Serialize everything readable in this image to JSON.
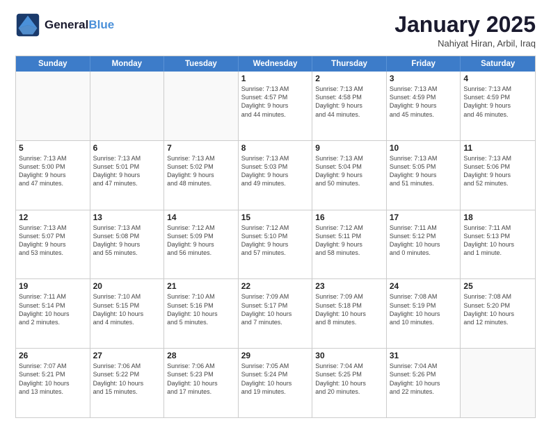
{
  "logo": {
    "line1": "General",
    "line2": "Blue"
  },
  "title": "January 2025",
  "subtitle": "Nahiyat Hiran, Arbil, Iraq",
  "days": [
    "Sunday",
    "Monday",
    "Tuesday",
    "Wednesday",
    "Thursday",
    "Friday",
    "Saturday"
  ],
  "weeks": [
    [
      {
        "num": "",
        "info": ""
      },
      {
        "num": "",
        "info": ""
      },
      {
        "num": "",
        "info": ""
      },
      {
        "num": "1",
        "info": "Sunrise: 7:13 AM\nSunset: 4:57 PM\nDaylight: 9 hours\nand 44 minutes."
      },
      {
        "num": "2",
        "info": "Sunrise: 7:13 AM\nSunset: 4:58 PM\nDaylight: 9 hours\nand 44 minutes."
      },
      {
        "num": "3",
        "info": "Sunrise: 7:13 AM\nSunset: 4:59 PM\nDaylight: 9 hours\nand 45 minutes."
      },
      {
        "num": "4",
        "info": "Sunrise: 7:13 AM\nSunset: 4:59 PM\nDaylight: 9 hours\nand 46 minutes."
      }
    ],
    [
      {
        "num": "5",
        "info": "Sunrise: 7:13 AM\nSunset: 5:00 PM\nDaylight: 9 hours\nand 47 minutes."
      },
      {
        "num": "6",
        "info": "Sunrise: 7:13 AM\nSunset: 5:01 PM\nDaylight: 9 hours\nand 47 minutes."
      },
      {
        "num": "7",
        "info": "Sunrise: 7:13 AM\nSunset: 5:02 PM\nDaylight: 9 hours\nand 48 minutes."
      },
      {
        "num": "8",
        "info": "Sunrise: 7:13 AM\nSunset: 5:03 PM\nDaylight: 9 hours\nand 49 minutes."
      },
      {
        "num": "9",
        "info": "Sunrise: 7:13 AM\nSunset: 5:04 PM\nDaylight: 9 hours\nand 50 minutes."
      },
      {
        "num": "10",
        "info": "Sunrise: 7:13 AM\nSunset: 5:05 PM\nDaylight: 9 hours\nand 51 minutes."
      },
      {
        "num": "11",
        "info": "Sunrise: 7:13 AM\nSunset: 5:06 PM\nDaylight: 9 hours\nand 52 minutes."
      }
    ],
    [
      {
        "num": "12",
        "info": "Sunrise: 7:13 AM\nSunset: 5:07 PM\nDaylight: 9 hours\nand 53 minutes."
      },
      {
        "num": "13",
        "info": "Sunrise: 7:13 AM\nSunset: 5:08 PM\nDaylight: 9 hours\nand 55 minutes."
      },
      {
        "num": "14",
        "info": "Sunrise: 7:12 AM\nSunset: 5:09 PM\nDaylight: 9 hours\nand 56 minutes."
      },
      {
        "num": "15",
        "info": "Sunrise: 7:12 AM\nSunset: 5:10 PM\nDaylight: 9 hours\nand 57 minutes."
      },
      {
        "num": "16",
        "info": "Sunrise: 7:12 AM\nSunset: 5:11 PM\nDaylight: 9 hours\nand 58 minutes."
      },
      {
        "num": "17",
        "info": "Sunrise: 7:11 AM\nSunset: 5:12 PM\nDaylight: 10 hours\nand 0 minutes."
      },
      {
        "num": "18",
        "info": "Sunrise: 7:11 AM\nSunset: 5:13 PM\nDaylight: 10 hours\nand 1 minute."
      }
    ],
    [
      {
        "num": "19",
        "info": "Sunrise: 7:11 AM\nSunset: 5:14 PM\nDaylight: 10 hours\nand 2 minutes."
      },
      {
        "num": "20",
        "info": "Sunrise: 7:10 AM\nSunset: 5:15 PM\nDaylight: 10 hours\nand 4 minutes."
      },
      {
        "num": "21",
        "info": "Sunrise: 7:10 AM\nSunset: 5:16 PM\nDaylight: 10 hours\nand 5 minutes."
      },
      {
        "num": "22",
        "info": "Sunrise: 7:09 AM\nSunset: 5:17 PM\nDaylight: 10 hours\nand 7 minutes."
      },
      {
        "num": "23",
        "info": "Sunrise: 7:09 AM\nSunset: 5:18 PM\nDaylight: 10 hours\nand 8 minutes."
      },
      {
        "num": "24",
        "info": "Sunrise: 7:08 AM\nSunset: 5:19 PM\nDaylight: 10 hours\nand 10 minutes."
      },
      {
        "num": "25",
        "info": "Sunrise: 7:08 AM\nSunset: 5:20 PM\nDaylight: 10 hours\nand 12 minutes."
      }
    ],
    [
      {
        "num": "26",
        "info": "Sunrise: 7:07 AM\nSunset: 5:21 PM\nDaylight: 10 hours\nand 13 minutes."
      },
      {
        "num": "27",
        "info": "Sunrise: 7:06 AM\nSunset: 5:22 PM\nDaylight: 10 hours\nand 15 minutes."
      },
      {
        "num": "28",
        "info": "Sunrise: 7:06 AM\nSunset: 5:23 PM\nDaylight: 10 hours\nand 17 minutes."
      },
      {
        "num": "29",
        "info": "Sunrise: 7:05 AM\nSunset: 5:24 PM\nDaylight: 10 hours\nand 19 minutes."
      },
      {
        "num": "30",
        "info": "Sunrise: 7:04 AM\nSunset: 5:25 PM\nDaylight: 10 hours\nand 20 minutes."
      },
      {
        "num": "31",
        "info": "Sunrise: 7:04 AM\nSunset: 5:26 PM\nDaylight: 10 hours\nand 22 minutes."
      },
      {
        "num": "",
        "info": ""
      }
    ]
  ]
}
